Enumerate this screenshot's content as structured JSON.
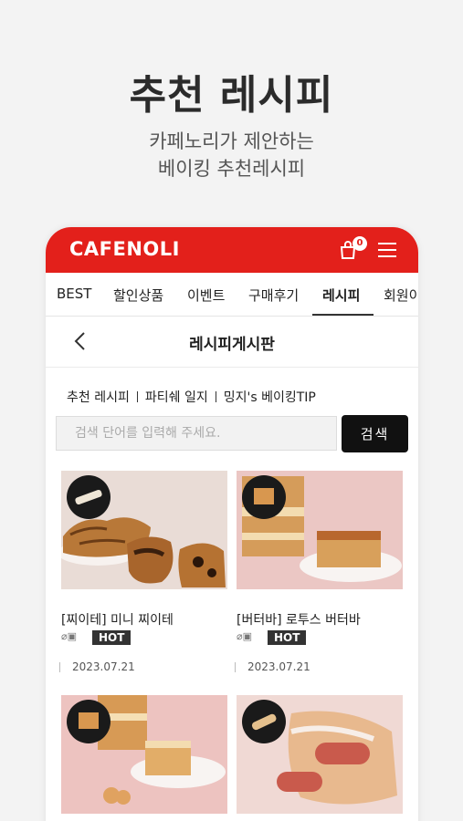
{
  "promo": {
    "title": "추천 레시피",
    "subtitle_line1": "카페노리가 제안하는",
    "subtitle_line2": "베이킹 추천레시피"
  },
  "app": {
    "logo": "CAFENOLI",
    "cart_count": "0",
    "brand_color": "#e3201b"
  },
  "tabs": [
    {
      "label": "BEST"
    },
    {
      "label": "할인상품"
    },
    {
      "label": "이벤트"
    },
    {
      "label": "구매후기"
    },
    {
      "label": "레시피",
      "active": true
    },
    {
      "label": "회원이"
    }
  ],
  "board": {
    "title": "레시피게시판",
    "categories": [
      "추천 레시피",
      "파티쉐 일지",
      "밍지's 베이킹TIP"
    ],
    "search_placeholder": "검색 단어를 입력해 주세요.",
    "search_button": "검색"
  },
  "posts": [
    {
      "title": "[찌이테] 미니 찌이테",
      "tag": "HOT",
      "date": "2023.07.21",
      "icons": "attachment-icon, image-icon"
    },
    {
      "title": "[버터바] 로투스 버터바",
      "tag": "HOT",
      "date": "2023.07.21",
      "icons": "attachment-icon, image-icon"
    },
    {
      "title": "",
      "tag": "",
      "date": ""
    },
    {
      "title": "",
      "tag": "",
      "date": ""
    }
  ]
}
